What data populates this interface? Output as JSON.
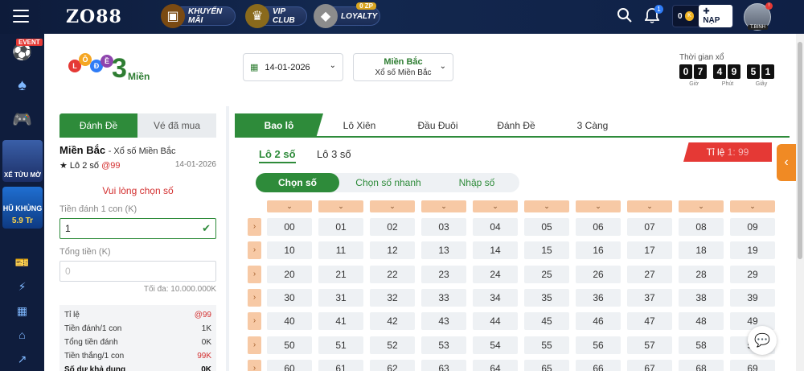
{
  "topbar": {
    "brand": "ZO88",
    "promos": [
      {
        "label": "KHUYẾN MÃI",
        "icon": "treasure-chest-icon"
      },
      {
        "label": "VIP CLUB",
        "icon": "crown-wings-icon"
      },
      {
        "label": "LOYALTY",
        "icon": "diamond-icon",
        "badge": "0 ZP"
      }
    ],
    "notification_count": "1",
    "balance": "0",
    "balance_unit": "K",
    "deposit_label": "NẠP",
    "avatar_label": "T.BINH",
    "avatar_alert": "!"
  },
  "sidebar": {
    "event_label": "EVENT",
    "promo_1": "XẾ TỬU MỜ",
    "promo_2_top": "HŨ KHỦNG",
    "promo_2_value": "5.9 Tr"
  },
  "header": {
    "logo_text": "Miền",
    "logo_balls": [
      "L",
      "Ô",
      "Đ",
      "Ề"
    ],
    "logo_number": "3",
    "date": "14-01-2026",
    "region_name": "Miền Bắc",
    "region_sub": "Xổ số Miền Bắc",
    "timer_label": "Thời gian xổ",
    "timer": {
      "hours": [
        "0",
        "7"
      ],
      "minutes": [
        "4",
        "9"
      ],
      "seconds": [
        "5",
        "1"
      ],
      "hours_label": "Giờ",
      "minutes_label": "Phút",
      "seconds_label": "Giây"
    }
  },
  "bet_panel": {
    "tab_active": "Đánh Đề",
    "tab_inactive": "Vé đã mua",
    "region": "Miền Bắc",
    "region_sub": "- Xổ số Miền Bắc",
    "bet_type": "★ Lô 2 số",
    "bet_odds": "@99",
    "bet_date": "14-01-2026",
    "warning": "Vui lòng chọn số",
    "amount_label": "Tiền đánh 1 con (K)",
    "amount_value": "1",
    "total_label": "Tổng tiền (K)",
    "total_placeholder": "0",
    "max_label": "Tối đa: 10.000.000K",
    "summary": [
      {
        "label": "Tỉ lệ",
        "value": "@99",
        "style": "red"
      },
      {
        "label": "Tiền đánh/1 con",
        "value": "1K",
        "style": ""
      },
      {
        "label": "Tổng tiền đánh",
        "value": "0K",
        "style": ""
      },
      {
        "label": "Tiền thắng/1 con",
        "value": "99K",
        "style": "red"
      },
      {
        "label": "Số dư khả dụng",
        "value": "0K",
        "style": "bold"
      }
    ]
  },
  "main": {
    "tabs": [
      "Bao lô",
      "Lô Xiên",
      "Đầu Đuôi",
      "Đánh Đề",
      "3 Càng"
    ],
    "sub_tabs": [
      "Lô 2 số",
      "Lô 3 số"
    ],
    "rate_prefix": "Tỉ lệ",
    "rate_value": "1: 99",
    "modes": [
      "Chọn số",
      "Chọn số nhanh",
      "Nhập số"
    ],
    "rows": [
      [
        "00",
        "01",
        "02",
        "03",
        "04",
        "05",
        "06",
        "07",
        "08",
        "09"
      ],
      [
        "10",
        "11",
        "12",
        "13",
        "14",
        "15",
        "16",
        "17",
        "18",
        "19"
      ],
      [
        "20",
        "21",
        "22",
        "23",
        "24",
        "25",
        "26",
        "27",
        "28",
        "29"
      ],
      [
        "30",
        "31",
        "32",
        "33",
        "34",
        "35",
        "36",
        "37",
        "38",
        "39"
      ],
      [
        "40",
        "41",
        "42",
        "43",
        "44",
        "45",
        "46",
        "47",
        "48",
        "49"
      ],
      [
        "50",
        "51",
        "52",
        "53",
        "54",
        "55",
        "56",
        "57",
        "58",
        "59"
      ],
      [
        "60",
        "61",
        "62",
        "63",
        "64",
        "65",
        "66",
        "67",
        "68",
        "69"
      ]
    ]
  },
  "colors": {
    "primary_green": "#2e8b3a",
    "accent_red": "#e53935",
    "accent_orange": "#f08a24",
    "topbar_bg": "#0f1d3d"
  }
}
